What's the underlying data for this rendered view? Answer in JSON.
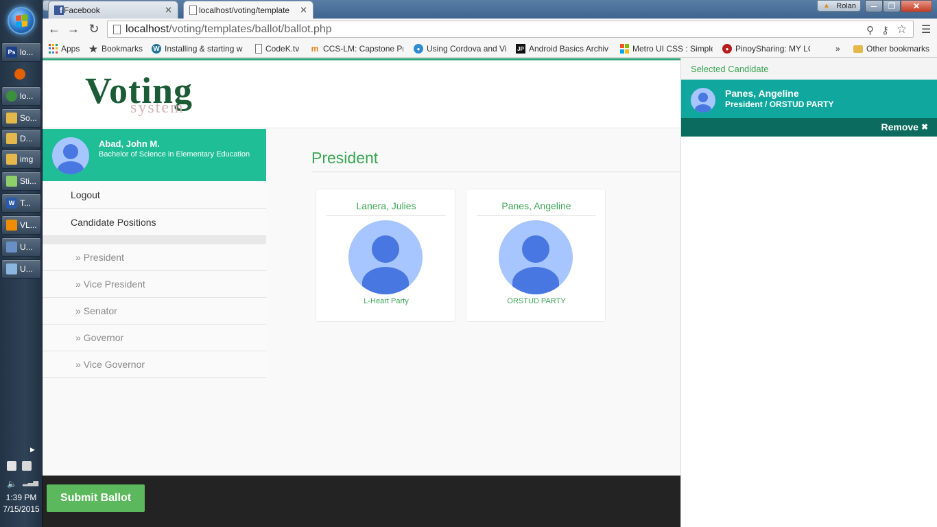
{
  "taskbar": {
    "items": [
      {
        "label": "lo...",
        "icon": "photoshop-icon",
        "abbr": "Ps",
        "color": "#1c3f8a"
      },
      {
        "label": "",
        "icon": "firefox-icon",
        "color": "#e66000"
      },
      {
        "label": "lo...",
        "icon": "chrome-icon",
        "color": "#3c8f3c"
      },
      {
        "label": "So...",
        "icon": "folder-icon",
        "color": "#e4b84a"
      },
      {
        "label": "D...",
        "icon": "folder-icon",
        "color": "#e4b84a"
      },
      {
        "label": "img",
        "icon": "folder-icon",
        "color": "#e4b84a"
      },
      {
        "label": "Sti...",
        "icon": "sticky-notes-icon",
        "color": "#8fcf6b"
      },
      {
        "label": "T...",
        "icon": "word-icon",
        "abbr": "W",
        "color": "#2a5aa8"
      },
      {
        "label": "VL...",
        "icon": "vlc-icon",
        "color": "#f08c00"
      },
      {
        "label": "U...",
        "icon": "paint-icon",
        "color": "#6a8fc4"
      },
      {
        "label": "U...",
        "icon": "notepad-icon",
        "color": "#8bb6e0"
      }
    ],
    "clock_time": "1:39 PM",
    "clock_date": "7/15/2015"
  },
  "browser": {
    "tabs": [
      {
        "label": "Facebook",
        "icon": "facebook-icon"
      },
      {
        "label": "localhost/voting/template",
        "icon": "page-icon"
      }
    ],
    "user_label": "Rolan",
    "url_host": "localhost",
    "url_path": "/voting/templates/ballot/ballot.php",
    "bookmarks": [
      {
        "label": "Apps",
        "icon": "apps-grid-icon"
      },
      {
        "label": "Bookmarks",
        "icon": "star-icon"
      },
      {
        "label": "Installing & starting w",
        "icon": "wordpress-icon"
      },
      {
        "label": "CodeK.tv",
        "icon": "page-icon"
      },
      {
        "label": "CCS-LM: Capstone Pr",
        "icon": "moodle-icon"
      },
      {
        "label": "Using Cordova and Vi",
        "icon": "globe-icon"
      },
      {
        "label": "Android Basics Archiv",
        "icon": "jp-icon"
      },
      {
        "label": "Metro UI CSS : Simple",
        "icon": "windows-icon"
      },
      {
        "label": "PinoySharing: MY LO",
        "icon": "pinoy-icon"
      },
      {
        "label": "Other bookmarks",
        "icon": "folder-icon"
      }
    ]
  },
  "app": {
    "logo_main": "Voting",
    "logo_sub": "system",
    "user": {
      "name": "Abad, John M.",
      "course": "Bachelor of Science in Elementary Education"
    },
    "menu": {
      "logout": "Logout",
      "positions": "Candidate Positions",
      "sub_items": [
        "President",
        "Vice President",
        "Senator",
        "Governor",
        "Vice Governor"
      ]
    },
    "section_title": "President",
    "candidates": [
      {
        "name": "Lanera, Julies",
        "party": "L-Heart Party"
      },
      {
        "name": "Panes, Angeline",
        "party": "ORSTUD PARTY"
      }
    ],
    "submit_label": "Submit Ballot",
    "selected": {
      "title": "Selected Candidate",
      "name": "Panes, Angeline",
      "position_party": "President / ORSTUD PARTY",
      "remove_label": "Remove"
    }
  },
  "colors": {
    "accent_green": "#3aa553",
    "profile_teal": "#1fbe96",
    "selected_teal": "#10a89e",
    "submit_green": "#5cb85c",
    "avatar_light": "#a7c5ff",
    "avatar_dark": "#4877e2"
  }
}
